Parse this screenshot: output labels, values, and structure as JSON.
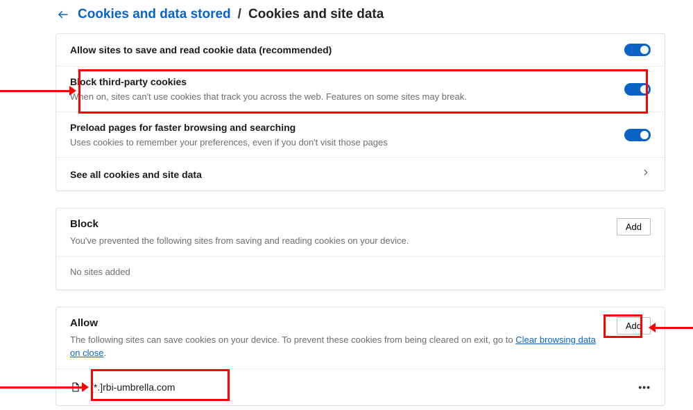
{
  "breadcrumb": {
    "parent": "Cookies and data stored",
    "separator": "/",
    "current": "Cookies and site data"
  },
  "settings": {
    "allow_cookies": {
      "label": "Allow sites to save and read cookie data (recommended)",
      "enabled": true
    },
    "block_third_party": {
      "label": "Block third-party cookies",
      "description": "When on, sites can't use cookies that track you across the web. Features on some sites may break.",
      "enabled": true
    },
    "preload": {
      "label": "Preload pages for faster browsing and searching",
      "description": "Uses cookies to remember your preferences, even if you don't visit those pages",
      "enabled": true
    },
    "see_all": {
      "label": "See all cookies and site data"
    }
  },
  "block_section": {
    "title": "Block",
    "description": "You've prevented the following sites from saving and reading cookies on your device.",
    "add_label": "Add",
    "empty_text": "No sites added"
  },
  "allow_section": {
    "title": "Allow",
    "description_prefix": "The following sites can save cookies on your device. To prevent these cookies from being cleared on exit, go to ",
    "description_link": "Clear browsing data on close",
    "description_suffix": ".",
    "add_label": "Add",
    "sites": [
      {
        "domain": "[*.]rbi-umbrella.com"
      }
    ]
  }
}
